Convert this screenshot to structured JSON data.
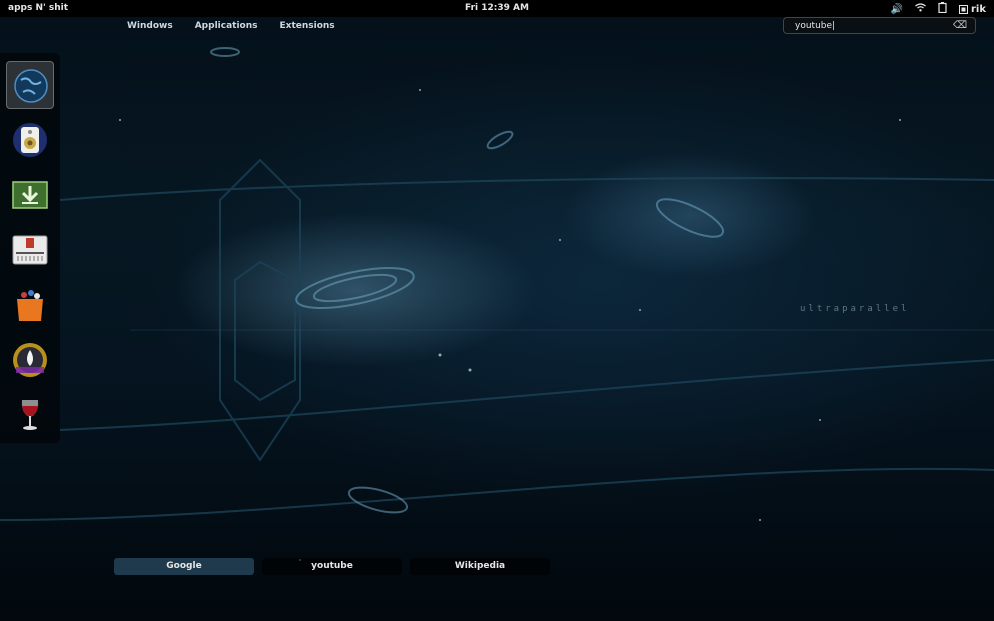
{
  "top_panel": {
    "activities_label": "apps N' shit",
    "clock": "Fri 12:39 AM",
    "user": "rik",
    "tray_icons": [
      "volume-icon",
      "wifi-icon",
      "battery-icon",
      "user-icon"
    ]
  },
  "overview_tabs": [
    "Windows",
    "Applications",
    "Extensions"
  ],
  "search": {
    "value": "youtube|",
    "clear_icon": "clear-icon"
  },
  "dash": {
    "items": [
      {
        "name": "globe-app",
        "active": true
      },
      {
        "name": "speaker-app",
        "active": false
      },
      {
        "name": "download-app",
        "active": false
      },
      {
        "name": "mixer-app",
        "active": false
      },
      {
        "name": "shopping-bag-app",
        "active": false
      },
      {
        "name": "mount-app",
        "active": false
      },
      {
        "name": "wine-app",
        "active": false
      }
    ]
  },
  "wallpaper_brand": "ultraparallel",
  "search_providers": [
    {
      "label": "Google",
      "selected": true
    },
    {
      "label": "youtube",
      "selected": false
    },
    {
      "label": "Wikipedia",
      "selected": false
    }
  ],
  "colors": {
    "accent": "#1f3a4c",
    "panel": "#000000",
    "background": "#061722"
  }
}
